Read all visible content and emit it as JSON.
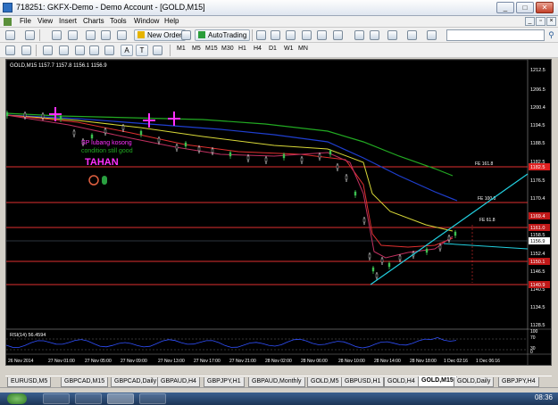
{
  "window": {
    "title": "718251: GKFX-Demo - Demo Account - [GOLD,M15]",
    "controls": {
      "minimize": "_",
      "maximize": "□",
      "close": "✕"
    }
  },
  "menu": [
    "File",
    "View",
    "Insert",
    "Charts",
    "Tools",
    "Window",
    "Help"
  ],
  "mdi_controls": {
    "minimize": "_",
    "restore": "▫",
    "close": "×"
  },
  "toolbar": {
    "new_order": "New Order",
    "autotrading": "AutoTrading",
    "text_tool": "A",
    "label_tool": "T",
    "timeframes": [
      "M1",
      "M5",
      "M15",
      "M30",
      "H1",
      "H4",
      "D1",
      "W1",
      "MN"
    ],
    "search_placeholder": ""
  },
  "chart": {
    "header": "GOLD,M15  1157.7 1157.8 1156.1 1156.9",
    "price_axis": [
      "1212.5",
      "1206.5",
      "1200.4",
      "1194.5",
      "1188.5",
      "1182.5",
      "1176.5",
      "1170.4",
      "1164.5",
      "1158.5",
      "1152.4",
      "1146.5",
      "1140.5",
      "1134.5",
      "1128.5"
    ],
    "price_tags": [
      {
        "label": "1182.5",
        "color": "#e02020"
      },
      {
        "label": "1169.4",
        "color": "#c01818"
      },
      {
        "label": "1161.0",
        "color": "#c01818"
      },
      {
        "label": "1156.9",
        "color": "#ffffff"
      },
      {
        "label": "1150.1",
        "color": "#c01818"
      },
      {
        "label": "1140.9",
        "color": "#c01818"
      }
    ],
    "fibo_labels": [
      "FE 161.8",
      "FE 100.0",
      "FE 61.8"
    ],
    "annotations": {
      "line1": "SP lubang kosong",
      "line2": "condition still good",
      "line3": "TAHAN"
    },
    "rsi_header": "RSI(14) 56.4594",
    "rsi_axis": [
      "100",
      "70",
      "30",
      "0"
    ],
    "time_axis": [
      "26 Nov 2014",
      "27 Nov 01:00",
      "27 Nov 05:00",
      "27 Nov 09:00",
      "27 Nov 13:00",
      "27 Nov 17:00",
      "27 Nov 21:00",
      "28 Nov 02:00",
      "28 Nov 06:00",
      "28 Nov 10:00",
      "28 Nov 14:00",
      "28 Nov 18:00",
      "1 Dec 02:16",
      "1 Dec 06:16"
    ]
  },
  "tabs": [
    {
      "label": "EURUSD,M5",
      "active": false
    },
    {
      "label": "GBPCAD,M15",
      "active": false
    },
    {
      "label": "GBPCAD,Daily",
      "active": false
    },
    {
      "label": "GBPAUD,H4",
      "active": false
    },
    {
      "label": "GBPJPY,H1",
      "active": false
    },
    {
      "label": "GBPAUD,Monthly",
      "active": false
    },
    {
      "label": "GOLD,M5",
      "active": false
    },
    {
      "label": "GBPUSD,H1",
      "active": false
    },
    {
      "label": "GOLD,H4",
      "active": false
    },
    {
      "label": "GOLD,M15",
      "active": true
    },
    {
      "label": "GOLD,Daily",
      "active": false
    },
    {
      "label": "GBPJPY,H4",
      "active": false
    }
  ],
  "taskbar": {
    "time": "08:36"
  },
  "colors": {
    "chart_bg": "#000000",
    "ma_green": "#22aa22",
    "ma_blue": "#1f3fd0",
    "ma_yellow": "#d8d838",
    "ma_red": "#e03030",
    "trend_cyan": "#22d0e0",
    "annotation_magenta": "#ff30ff",
    "rsi_blue": "#3050ff"
  }
}
